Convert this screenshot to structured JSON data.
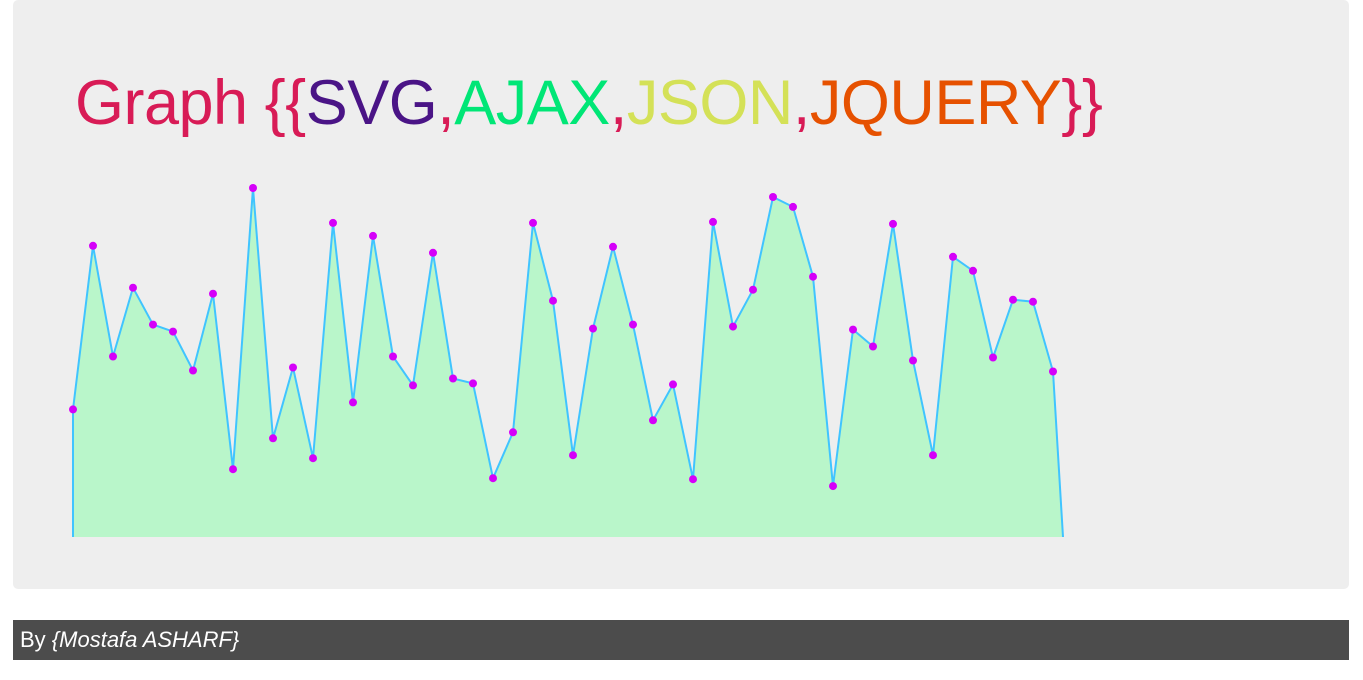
{
  "title": {
    "prefix": "Graph ",
    "open": "{{",
    "svg": "SVG",
    "sep1": ",",
    "ajax": "AJAX",
    "sep2": ",",
    "json": "JSON",
    "sep3": ",",
    "jquery": "JQUERY",
    "close": "}}"
  },
  "colors": {
    "title_main": "#d81b56",
    "svg": "#4a1486",
    "ajax": "#00e676",
    "json": "#d4e157",
    "jquery": "#e65100",
    "area_fill": "#b9f6ca",
    "line": "#40c4ff",
    "point": "#d500f9",
    "panel_bg": "#eeeeee",
    "footer_bg": "#4c4c4c"
  },
  "footer": {
    "by": "By ",
    "author": "{Mostafa ASHARF}"
  },
  "chart_data": {
    "type": "area",
    "title": "",
    "xlabel": "",
    "ylabel": "",
    "ylim": [
      0,
      350
    ],
    "values": [
      128,
      292,
      181,
      250,
      213,
      206,
      167,
      244,
      68,
      350,
      99,
      170,
      79,
      315,
      135,
      302,
      181,
      152,
      285,
      159,
      154,
      59,
      105,
      315,
      237,
      82,
      209,
      291,
      213,
      117,
      153,
      58,
      316,
      211,
      248,
      341,
      331,
      261,
      51,
      208,
      191,
      314,
      177,
      82,
      281,
      267,
      180,
      238,
      236,
      166
    ]
  }
}
